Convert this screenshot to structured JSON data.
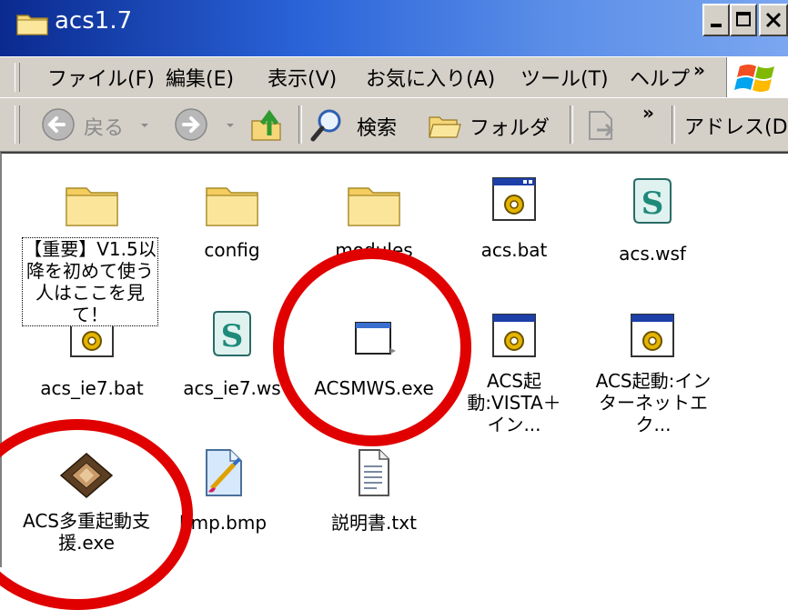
{
  "window": {
    "title": "acs1.7"
  },
  "menu": {
    "items": [
      "ファイル(F)",
      "編集(E)",
      "表示(V)",
      "お気に入り(A)",
      "ツール(T)",
      "ヘルプ"
    ],
    "chevron": "»"
  },
  "toolbar": {
    "back_label": "戻る",
    "search_label": "検索",
    "folders_label": "フォルダ",
    "chevron": "»",
    "address_label": "アドレス(D)"
  },
  "files": [
    {
      "name": "",
      "type": "folder"
    },
    {
      "name": "config",
      "type": "folder"
    },
    {
      "name": "modules",
      "type": "folder"
    },
    {
      "name": "acs.bat",
      "type": "batch"
    },
    {
      "name": "acs.wsf",
      "type": "script"
    },
    {
      "name": "acs_ie7.bat",
      "type": "batch"
    },
    {
      "name": "acs_ie7.ws",
      "type": "script"
    },
    {
      "name": "ACSMWS.exe",
      "type": "exe"
    },
    {
      "name": "ACS起動:VISTA＋イン...",
      "type": "batch"
    },
    {
      "name": "ACS起動:インターネットエク...",
      "type": "batch"
    },
    {
      "name": "ACS多重起動支援.exe",
      "type": "chip-exe"
    },
    {
      "name": "bmp.bmp",
      "type": "bitmap"
    },
    {
      "name": "説明書.txt",
      "type": "text"
    }
  ],
  "tooltip": {
    "text": "【重要】V1.5以降を初めて使う人はここを見て！"
  },
  "annotation_color": "#e00000"
}
